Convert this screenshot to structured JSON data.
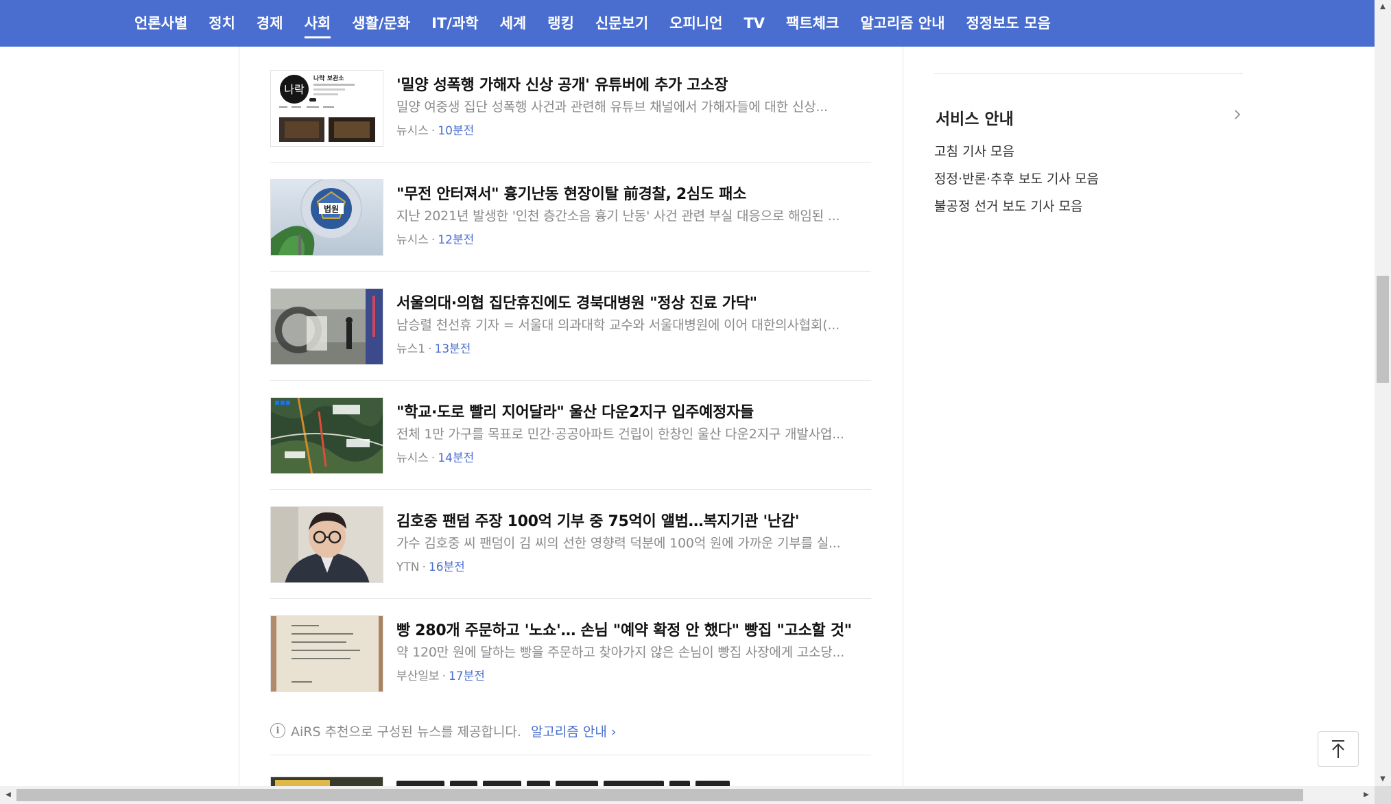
{
  "nav": {
    "items": [
      {
        "label": "언론사별"
      },
      {
        "label": "정치"
      },
      {
        "label": "경제"
      },
      {
        "label": "사회",
        "active": true
      },
      {
        "label": "생활/문화"
      },
      {
        "label": "IT/과학"
      },
      {
        "label": "세계"
      },
      {
        "label": "랭킹"
      },
      {
        "label": "신문보기"
      },
      {
        "label": "오피니언"
      },
      {
        "label": "TV"
      },
      {
        "label": "팩트체크"
      },
      {
        "label": "알고리즘 안내"
      },
      {
        "label": "정정보도 모음"
      }
    ]
  },
  "articles": [
    {
      "title": "'밀양 성폭행 가해자 신상 공개' 유튜버에 추가 고소장",
      "summary": "밀양 여중생 집단 성폭행 사건과 관련해 유튜브 채널에서 가해자들에 대한 신상...",
      "source": "뉴시스",
      "time": "10분전",
      "thumb_text": "나락 보관소",
      "thumb_logo": "나락"
    },
    {
      "title": "\"무전 안터져서\" 흉기난동 현장이탈 前경찰, 2심도 패소",
      "summary": "지난 2021년 발생한 '인천 층간소음 흉기 난동' 사건 관련 부실 대응으로 해임된 ...",
      "source": "뉴시스",
      "time": "12분전",
      "thumb_text": "법원"
    },
    {
      "title": "서울의대·의협 집단휴진에도 경북대병원 \"정상 진료 가닥\"",
      "summary": "남승렬 천선휴 기자 = 서울대 의과대학 교수와 서울대병원에 이어 대한의사협회(...",
      "source": "뉴스1",
      "time": "13분전"
    },
    {
      "title": "\"학교·도로 빨리 지어달라\" 울산 다운2지구 입주예정자들",
      "summary": "전체 1만 가구를 목표로 민간·공공아파트 건립이 한창인 울산 다운2지구 개발사업...",
      "source": "뉴시스",
      "time": "14분전"
    },
    {
      "title": "김호중 팬덤 주장 100억 기부 중 75억이 앨범…복지기관 '난감'",
      "summary": "가수 김호중 씨 팬덤이 김 씨의 선한 영향력 덕분에 100억 원에 가까운 기부를 실...",
      "source": "YTN",
      "time": "16분전"
    },
    {
      "title": "빵 280개 주문하고 '노쇼'… 손님 \"예약 확정 안 했다\" 빵집 \"고소할 것\"",
      "summary": "약 120만 원에 달하는 빵을 주문하고 찾아가지 않은 손님이 빵집 사장에게 고소당...",
      "source": "부산일보",
      "time": "17분전"
    }
  ],
  "airs": {
    "text": "AiRS 추천으로 구성된 뉴스를 제공합니다.",
    "link": "알고리즘 안내"
  },
  "service": {
    "title": "서비스 안내",
    "links": [
      "고침 기사 모음",
      "정정·반론·추후 보도 기사 모음",
      "불공정 선거 보도 기사 모음"
    ]
  },
  "colors": {
    "nav_bg": "#4a6ed0",
    "time_blue": "#4a6ed0",
    "summary_gray": "#8a8a8a"
  }
}
